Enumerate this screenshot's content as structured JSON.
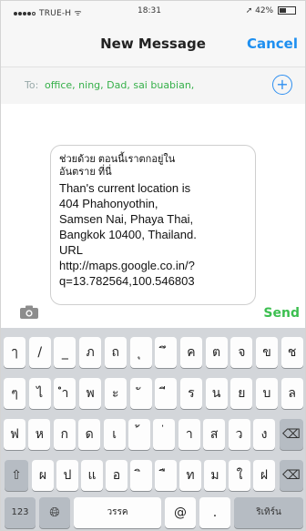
{
  "status_bar": {
    "carrier": "TRUE-H",
    "time": "18:31",
    "battery": "42%"
  },
  "nav": {
    "title": "New Message",
    "cancel_label": "Cancel"
  },
  "to_field": {
    "label": "To:",
    "recipients": "office, ning, Dad, sai buabian,"
  },
  "message": {
    "thai_line": "ช่วยด้วย ตอนนี้เราตกอยู่ใน\nอันตราย ที่นี่",
    "body": "Than's current location is\n404 Phahonyothin,\nSamsen Nai, Phaya Thai,\nBangkok 10400, Thailand.\nURL\nhttp://maps.google.co.in/?\nq=13.782564,100.546803"
  },
  "actions": {
    "send_label": "Send"
  },
  "keyboard": {
    "row1": [
      "ๅ",
      "/",
      "_",
      "ภ",
      "ถ",
      "ุ",
      "ึ",
      "ค",
      "ต",
      "จ",
      "ข",
      "ช"
    ],
    "row2": [
      "ๆ",
      "ไ",
      "ำ",
      "พ",
      "ะ",
      "ั",
      "ี",
      "ร",
      "น",
      "ย",
      "บ",
      "ล"
    ],
    "row3": [
      "ฟ",
      "ห",
      "ก",
      "ด",
      "เ",
      "้",
      "่",
      "า",
      "ส",
      "ว",
      "ง"
    ],
    "row4": [
      "ผ",
      "ป",
      "แ",
      "อ",
      "ิ",
      "ื",
      "ท",
      "ม",
      "ใ",
      "ฝ"
    ],
    "bottom": {
      "numbers": "123",
      "space": "วรรค",
      "at": "@",
      "dot": ".",
      "return": "ริเทิร์น"
    }
  },
  "colors": {
    "accent": "#1e8ff0",
    "send": "#3cbf50",
    "recipients": "#36b04a"
  }
}
